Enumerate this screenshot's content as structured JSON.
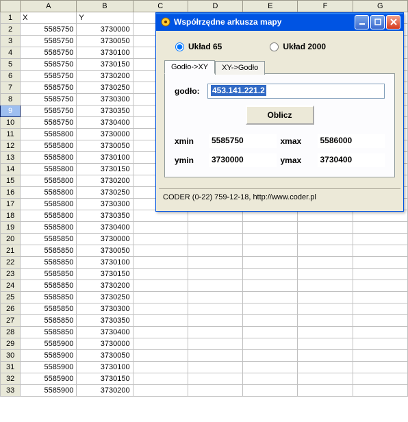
{
  "sheet": {
    "columns": [
      "A",
      "B",
      "C",
      "D",
      "E",
      "F",
      "G"
    ],
    "header_row": {
      "A": "X",
      "B": "Y"
    },
    "selected_row": 9,
    "selected_col": "E",
    "rows": [
      {
        "n": 1,
        "A": "X",
        "B": "Y",
        "left": true
      },
      {
        "n": 2,
        "A": "5585750",
        "B": "3730000"
      },
      {
        "n": 3,
        "A": "5585750",
        "B": "3730050"
      },
      {
        "n": 4,
        "A": "5585750",
        "B": "3730100"
      },
      {
        "n": 5,
        "A": "5585750",
        "B": "3730150"
      },
      {
        "n": 6,
        "A": "5585750",
        "B": "3730200"
      },
      {
        "n": 7,
        "A": "5585750",
        "B": "3730250"
      },
      {
        "n": 8,
        "A": "5585750",
        "B": "3730300"
      },
      {
        "n": 9,
        "A": "5585750",
        "B": "3730350"
      },
      {
        "n": 10,
        "A": "5585750",
        "B": "3730400"
      },
      {
        "n": 11,
        "A": "5585800",
        "B": "3730000"
      },
      {
        "n": 12,
        "A": "5585800",
        "B": "3730050"
      },
      {
        "n": 13,
        "A": "5585800",
        "B": "3730100"
      },
      {
        "n": 14,
        "A": "5585800",
        "B": "3730150"
      },
      {
        "n": 15,
        "A": "5585800",
        "B": "3730200"
      },
      {
        "n": 16,
        "A": "5585800",
        "B": "3730250"
      },
      {
        "n": 17,
        "A": "5585800",
        "B": "3730300"
      },
      {
        "n": 18,
        "A": "5585800",
        "B": "3730350"
      },
      {
        "n": 19,
        "A": "5585800",
        "B": "3730400"
      },
      {
        "n": 20,
        "A": "5585850",
        "B": "3730000"
      },
      {
        "n": 21,
        "A": "5585850",
        "B": "3730050"
      },
      {
        "n": 22,
        "A": "5585850",
        "B": "3730100"
      },
      {
        "n": 23,
        "A": "5585850",
        "B": "3730150"
      },
      {
        "n": 24,
        "A": "5585850",
        "B": "3730200"
      },
      {
        "n": 25,
        "A": "5585850",
        "B": "3730250"
      },
      {
        "n": 26,
        "A": "5585850",
        "B": "3730300"
      },
      {
        "n": 27,
        "A": "5585850",
        "B": "3730350"
      },
      {
        "n": 28,
        "A": "5585850",
        "B": "3730400"
      },
      {
        "n": 29,
        "A": "5585900",
        "B": "3730000"
      },
      {
        "n": 30,
        "A": "5585900",
        "B": "3730050"
      },
      {
        "n": 31,
        "A": "5585900",
        "B": "3730100"
      },
      {
        "n": 32,
        "A": "5585900",
        "B": "3730150"
      },
      {
        "n": 33,
        "A": "5585900",
        "B": "3730200"
      }
    ]
  },
  "dialog": {
    "title": "Współrzędne arkusza mapy",
    "radios": {
      "uklad65": "Układ 65",
      "uklad2000": "Układ 2000",
      "selected": "uklad65"
    },
    "tabs": {
      "godlo_xy": "Godło->XY",
      "xy_godlo": "XY->Godło",
      "active": "godlo_xy"
    },
    "godlo_label": "godło:",
    "godlo_value": "453.141.221.2",
    "oblicz_label": "Oblicz",
    "xmin_label": "xmin",
    "xmin_value": "5585750",
    "xmax_label": "xmax",
    "xmax_value": "5586000",
    "ymin_label": "ymin",
    "ymin_value": "3730000",
    "ymax_label": "ymax",
    "ymax_value": "3730400",
    "footer": "CODER (0-22) 759-12-18, http://www.coder.pl"
  }
}
